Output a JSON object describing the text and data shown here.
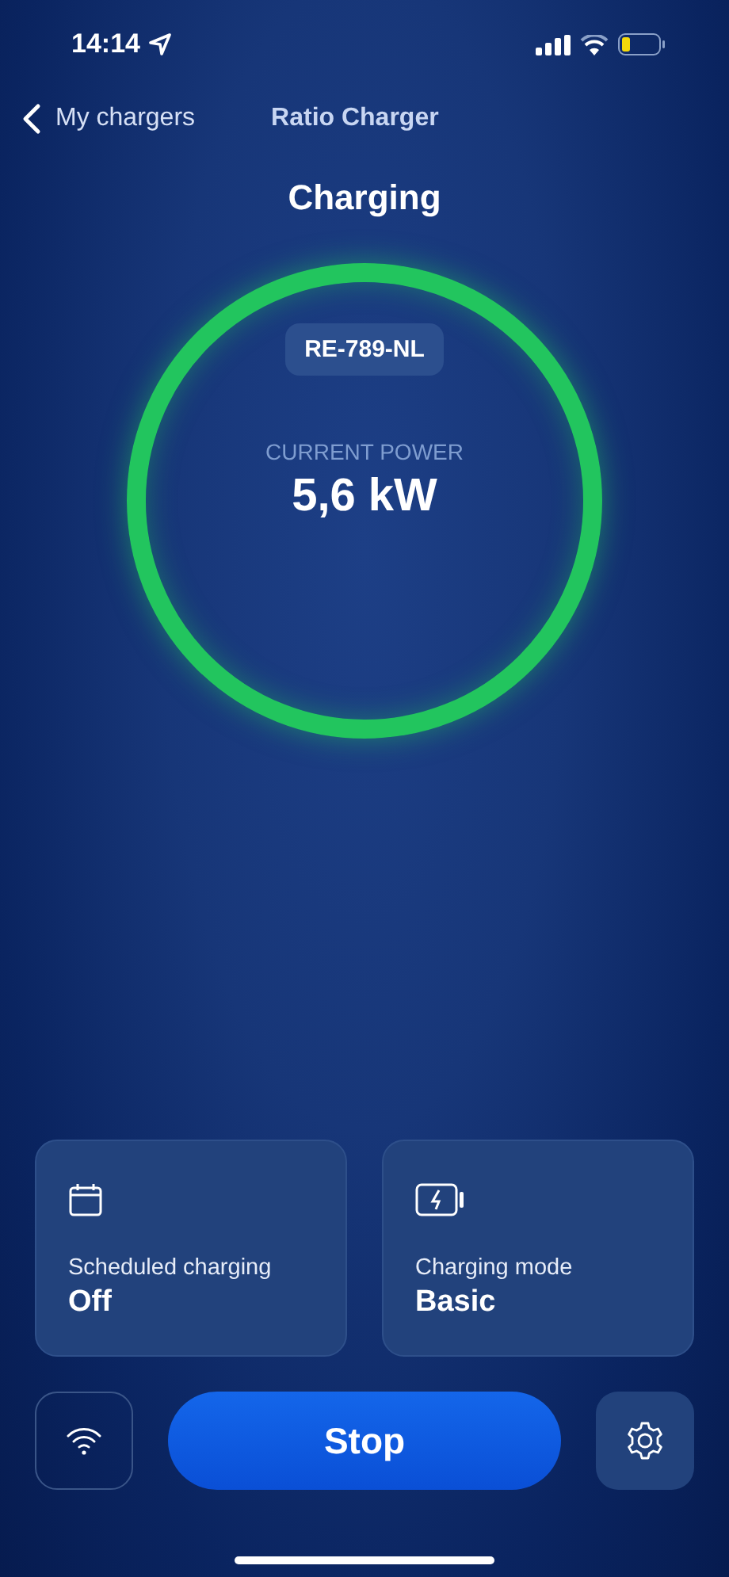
{
  "status_bar": {
    "time": "14:14"
  },
  "nav": {
    "back_label": "My chargers",
    "title": "Ratio Charger"
  },
  "status": {
    "title": "Charging",
    "plate": "RE-789-NL",
    "power_label": "CURRENT POWER",
    "power_value": "5,6 kW"
  },
  "cards": [
    {
      "kind": "calendar",
      "label": "Scheduled charging",
      "value": "Off"
    },
    {
      "kind": "battery",
      "label": "Charging mode",
      "value": "Basic"
    }
  ],
  "stop_button": {
    "label": "Stop"
  }
}
